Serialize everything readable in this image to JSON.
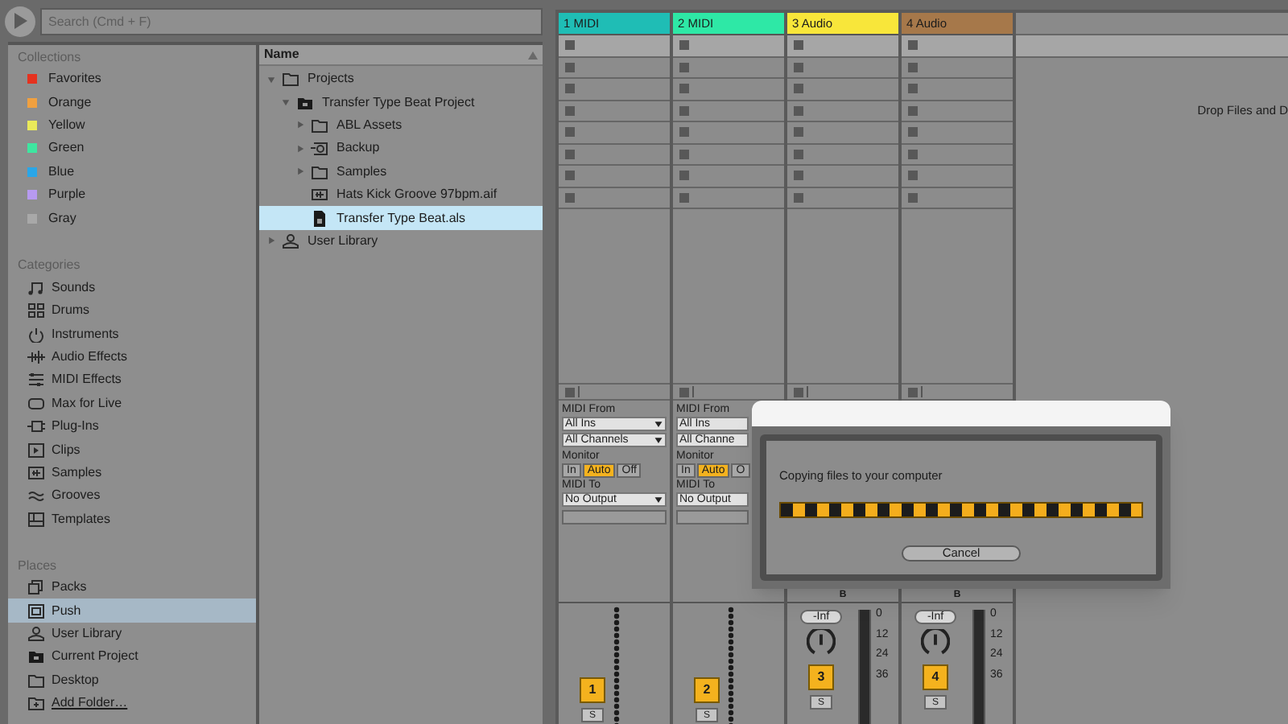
{
  "search": {
    "placeholder": "Search (Cmd + F)"
  },
  "browser": {
    "collections_heading": "Collections",
    "collections": [
      {
        "label": "Favorites",
        "color": "#e5321f"
      },
      {
        "label": "Orange",
        "color": "#f0a040"
      },
      {
        "label": "Yellow",
        "color": "#eaea5a"
      },
      {
        "label": "Green",
        "color": "#3ee6a0"
      },
      {
        "label": "Blue",
        "color": "#2aa6e8"
      },
      {
        "label": "Purple",
        "color": "#b79af0"
      },
      {
        "label": "Gray",
        "color": "#a8a8a8"
      }
    ],
    "categories_heading": "Categories",
    "categories": [
      {
        "label": "Sounds",
        "kind": "sounds"
      },
      {
        "label": "Drums",
        "kind": "drums"
      },
      {
        "label": "Instruments",
        "kind": "instruments"
      },
      {
        "label": "Audio Effects",
        "kind": "audiofx"
      },
      {
        "label": "MIDI Effects",
        "kind": "midifx"
      },
      {
        "label": "Max for Live",
        "kind": "max"
      },
      {
        "label": "Plug-Ins",
        "kind": "plugins"
      },
      {
        "label": "Clips",
        "kind": "clips"
      },
      {
        "label": "Samples",
        "kind": "samples"
      },
      {
        "label": "Grooves",
        "kind": "grooves"
      },
      {
        "label": "Templates",
        "kind": "templates"
      }
    ],
    "places_heading": "Places",
    "places": [
      {
        "label": "Packs",
        "kind": "packs",
        "selected": false
      },
      {
        "label": "Push",
        "kind": "push",
        "selected": true
      },
      {
        "label": "User Library",
        "kind": "user",
        "selected": false
      },
      {
        "label": "Current Project",
        "kind": "project",
        "selected": false
      },
      {
        "label": "Desktop",
        "kind": "folder",
        "selected": false
      },
      {
        "label": "Add Folder…",
        "kind": "add",
        "selected": false
      }
    ],
    "tree": {
      "column": "Name",
      "items": [
        {
          "label": "Projects",
          "kind": "folder",
          "expanded": true,
          "selected": false,
          "children": [
            {
              "label": "Transfer Type Beat Project",
              "kind": "project",
              "expanded": true,
              "selected": false,
              "children": [
                {
                  "label": "ABL Assets",
                  "kind": "folder",
                  "expanded": false,
                  "selected": false
                },
                {
                  "label": "Backup",
                  "kind": "backup",
                  "expanded": false,
                  "selected": false
                },
                {
                  "label": "Samples",
                  "kind": "folder",
                  "expanded": false,
                  "selected": false
                },
                {
                  "label": "Hats Kick Groove 97bpm.aif",
                  "kind": "audio",
                  "selected": false
                },
                {
                  "label": "Transfer Type Beat.als",
                  "kind": "set",
                  "selected": true
                }
              ]
            }
          ]
        },
        {
          "label": "User Library",
          "kind": "user",
          "expanded": false,
          "selected": false
        }
      ]
    }
  },
  "session": {
    "scenes": [
      {
        "selected": true
      },
      {
        "selected": false
      },
      {
        "selected": false
      },
      {
        "selected": false
      },
      {
        "selected": false
      },
      {
        "selected": false
      },
      {
        "selected": false
      },
      {
        "selected": false
      }
    ],
    "drop_hint": "Drop Files and D",
    "tracks": [
      {
        "name": "1 MIDI",
        "color": "#1fbdb5",
        "kind": "midi",
        "number": "1",
        "solo": "S",
        "io": {
          "from_label": "MIDI From",
          "from": "All Ins",
          "channel": "All Channels",
          "monitor_label": "Monitor",
          "monitor": [
            {
              "label": "In",
              "selected": false
            },
            {
              "label": "Auto",
              "selected": true
            },
            {
              "label": "Off",
              "selected": false
            }
          ],
          "to_label": "MIDI To",
          "to": "No Output"
        }
      },
      {
        "name": "2 MIDI",
        "color": "#2ee8a6",
        "kind": "midi",
        "number": "2",
        "solo": "S",
        "io": {
          "from_label": "MIDI From",
          "from": "All Ins",
          "channel": "All Channe",
          "monitor_label": "Monitor",
          "monitor": [
            {
              "label": "In",
              "selected": false
            },
            {
              "label": "Auto",
              "selected": true
            },
            {
              "label": "O",
              "selected": false
            }
          ],
          "to_label": "MIDI To",
          "to": "No Output"
        }
      },
      {
        "name": "3 Audio",
        "color": "#f8e63a",
        "kind": "audio",
        "number": "3",
        "solo": "S",
        "send_label": "B",
        "volume": "-Inf",
        "ticks": [
          "0",
          "12",
          "24",
          "36"
        ]
      },
      {
        "name": "4 Audio",
        "color": "#a6784a",
        "kind": "audio",
        "number": "4",
        "solo": "S",
        "send_label": "B",
        "volume": "-Inf",
        "ticks": [
          "0",
          "12",
          "24",
          "36"
        ]
      }
    ]
  },
  "dialog": {
    "message": "Copying files to your computer",
    "progress": {
      "indeterminate": true
    },
    "cancel": "Cancel"
  }
}
